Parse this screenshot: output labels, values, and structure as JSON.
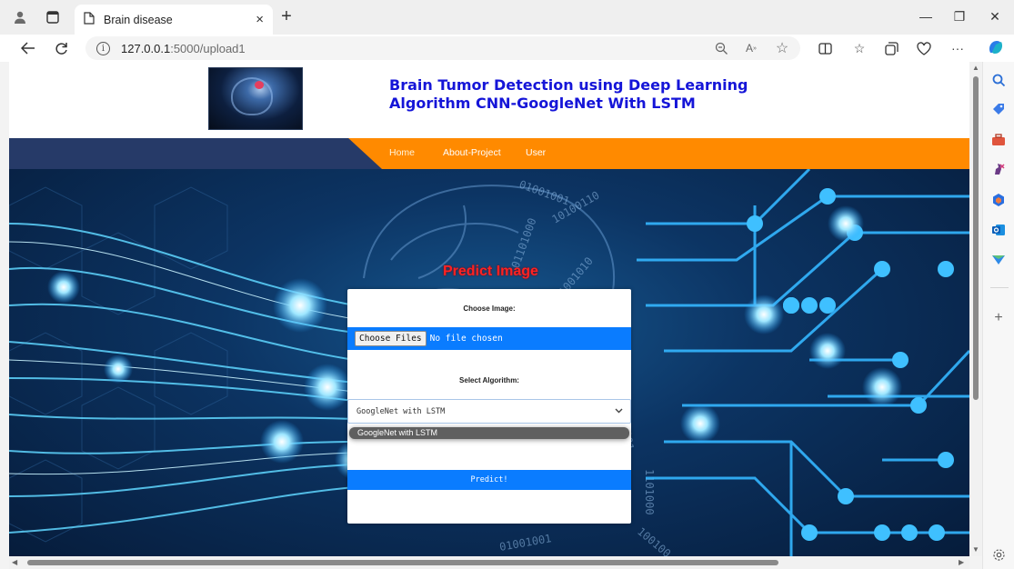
{
  "browser": {
    "tab_title": "Brain disease",
    "tab_close": "×",
    "new_tab": "+",
    "url_host": "127.0.0.1",
    "url_path": ":5000/upload1",
    "minimize": "—",
    "restore": "❐",
    "close": "✕"
  },
  "site": {
    "title": "Brain Tumor Detection using Deep Learning Algorithm CNN-GoogleNet With LSTM",
    "nav": [
      "Home",
      "About-Project",
      "User"
    ]
  },
  "form": {
    "heading": "Predict Image",
    "choose_label": "Choose Image:",
    "file_button": "Choose Files",
    "file_status": "No file chosen",
    "algo_label": "Select Algorithm:",
    "selected_algorithm": "GoogleNet with LSTM",
    "options": [
      "GoogleNet with LSTM"
    ],
    "submit": "Predict!"
  },
  "colors": {
    "title_blue": "#1515d8",
    "nav_orange": "#ff8a00",
    "nav_navy": "#263a68",
    "button_blue": "#0a7cff",
    "predict_red": "#ff2222"
  }
}
